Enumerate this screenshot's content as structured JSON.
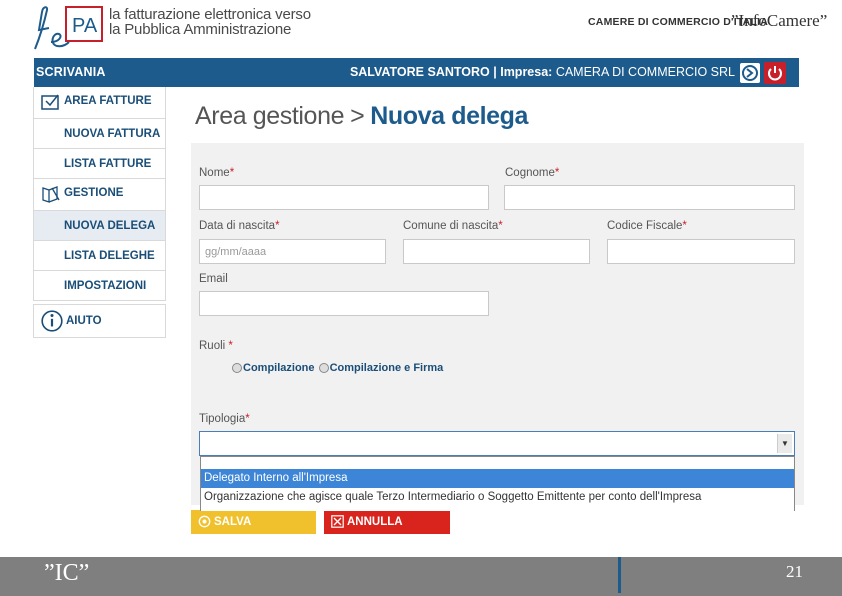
{
  "header": {
    "tagline_line1": "la fatturazione elettronica verso",
    "tagline_line2": "la Pubblica Amministrazione",
    "logo_text": "PA",
    "org_label": "CAMERE DI COMMERCIO D'ITALIA",
    "brand": "”InfoCamere”"
  },
  "topbar": {
    "title": "SCRIVANIA",
    "user_name": "SALVATORE SANTORO",
    "impresa_label": "| Impresa:",
    "impresa_value": "CAMERA DI COMMERCIO SRL",
    "colors": {
      "bar": "#1d5b8c",
      "power": "#c8202a"
    }
  },
  "sidebar": {
    "sections": [
      {
        "label": "AREA FATTURE",
        "icon": "invoice-area-icon"
      },
      {
        "label": "GESTIONE",
        "icon": "management-icon"
      },
      {
        "label": "AIUTO",
        "icon": "info-icon"
      }
    ],
    "items": [
      {
        "label": "NUOVA FATTURA"
      },
      {
        "label": "LISTA FATTURE"
      },
      {
        "label": "NUOVA DELEGA",
        "active": true
      },
      {
        "label": "LISTA DELEGHE"
      },
      {
        "label": "IMPOSTAZIONI"
      }
    ]
  },
  "breadcrumb": {
    "parent": "Area gestione",
    "separator": ">",
    "current": "Nuova delega"
  },
  "form": {
    "nome": {
      "label": "Nome",
      "required": "*",
      "value": ""
    },
    "cognome": {
      "label": "Cognome",
      "required": "*",
      "value": ""
    },
    "data_nascita": {
      "label": "Data di nascita",
      "required": "*",
      "placeholder": "gg/mm/aaaa"
    },
    "comune_nascita": {
      "label": "Comune di nascita",
      "required": "*",
      "value": ""
    },
    "codice_fiscale": {
      "label": "Codice Fiscale",
      "required": "*",
      "value": ""
    },
    "email": {
      "label": "Email",
      "value": ""
    },
    "ruoli": {
      "label": "Ruoli",
      "required": "*",
      "options": [
        "Compilazione",
        "Compilazione e Firma"
      ]
    },
    "tipologia": {
      "label": "Tipologia",
      "required": "*",
      "selected": "",
      "options": [
        "Delegato Interno all'Impresa",
        "Organizzazione che agisce quale Terzo Intermediario o Soggetto Emittente per conto dell'Impresa"
      ],
      "highlighted_index": 0
    }
  },
  "actions": {
    "save_label": "SALVA",
    "cancel_label": "ANNULLA",
    "colors": {
      "save": "#f0c12c",
      "cancel": "#d8241c"
    }
  },
  "footer": {
    "mark": "”IC”",
    "page_number": "21"
  }
}
